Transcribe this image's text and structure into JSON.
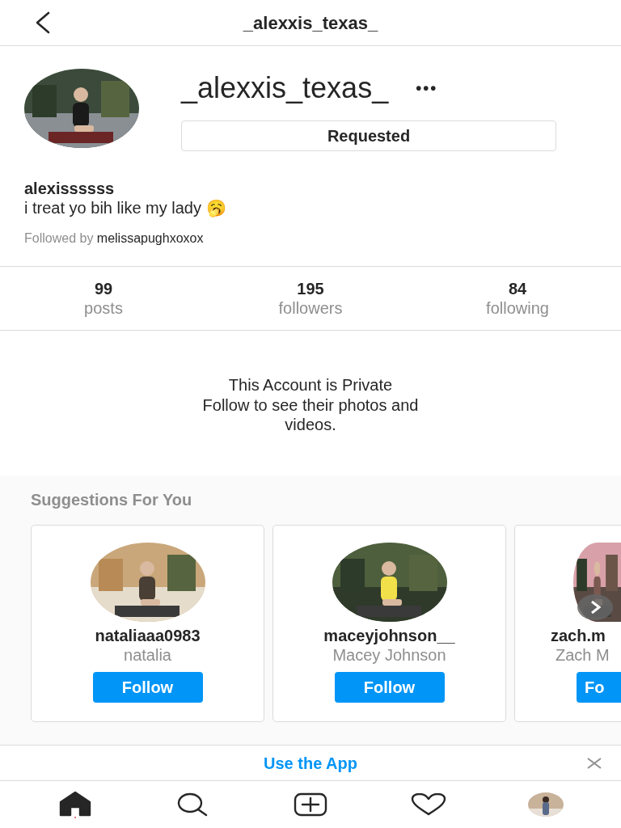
{
  "header": {
    "title": "_alexxis_texas_"
  },
  "profile": {
    "username": "_alexxis_texas_",
    "more": "•••",
    "button": "Requested",
    "name": "alexissssss",
    "bio": "i treat yo bih like my lady 🥱",
    "followed_by_label": "Followed by",
    "followed_by": "melissapughxoxox"
  },
  "stats": [
    {
      "value": "99",
      "label": "posts"
    },
    {
      "value": "195",
      "label": "followers"
    },
    {
      "value": "84",
      "label": "following"
    }
  ],
  "private": {
    "title": "This Account is Private",
    "text": "Follow to see their photos and videos."
  },
  "suggestions": {
    "title": "Suggestions For You",
    "cards": [
      {
        "username": "nataliaaa0983",
        "name": "natalia",
        "button": "Follow",
        "partial": false
      },
      {
        "username": "maceyjohnson__",
        "name": "Macey Johnson",
        "button": "Follow",
        "partial": false
      },
      {
        "username": "zach.m",
        "name": "Zach M",
        "button": "Fo",
        "partial": true
      }
    ]
  },
  "banner": {
    "text": "Use the App"
  },
  "nav": [
    {
      "kind": "home",
      "selected": true
    },
    {
      "kind": "search",
      "selected": false
    },
    {
      "kind": "new",
      "selected": false
    },
    {
      "kind": "activity",
      "selected": false
    },
    {
      "kind": "profile",
      "selected": false
    }
  ]
}
